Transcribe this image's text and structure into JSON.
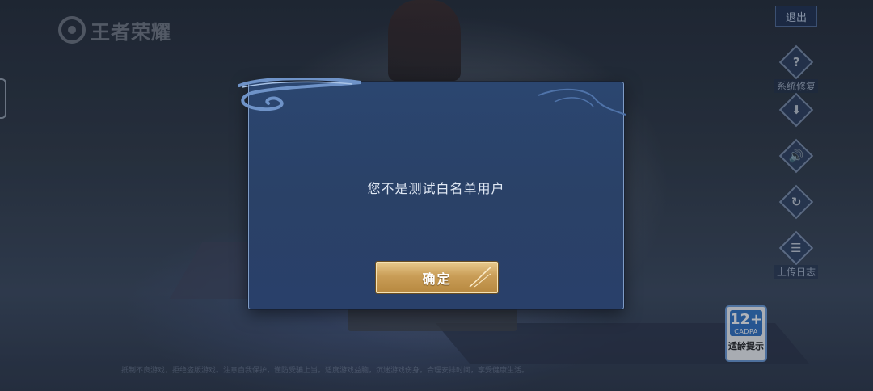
{
  "background": {
    "logo_text": "王者荣耀",
    "exit_button_label": "退出",
    "sidebar": [
      {
        "icon": "question-icon",
        "glyph": "?",
        "label": "系统修复"
      },
      {
        "icon": "download-icon",
        "glyph": "⬇",
        "label": ""
      },
      {
        "icon": "speaker-icon",
        "glyph": "🔊",
        "label": ""
      },
      {
        "icon": "refresh-icon",
        "glyph": "↻",
        "label": ""
      },
      {
        "icon": "notice-icon",
        "glyph": "☰",
        "label": "上传日志"
      }
    ],
    "age_badge": {
      "rating": "12+",
      "org": "CADPA",
      "label": "适龄提示"
    },
    "footer_text": "抵制不良游戏，拒绝盗版游戏。注意自我保护，谨防受骗上当。适度游戏益脑，沉迷游戏伤身。合理安排时间，享受健康生活。"
  },
  "dialog": {
    "message": "您不是测试白名单用户",
    "confirm_label": "确定"
  },
  "colors": {
    "dialog_bg": "#2a4167",
    "dialog_border": "#7f9cc6",
    "button_gold": "#c99d57",
    "text": "#dfe7f3"
  }
}
